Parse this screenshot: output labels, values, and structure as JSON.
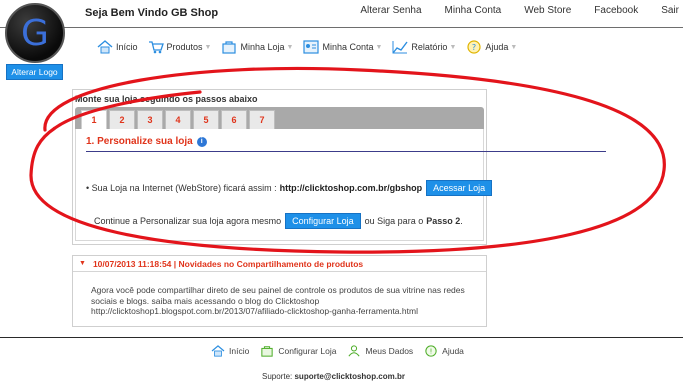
{
  "header": {
    "logo_letter": "G",
    "welcome": "Seja Bem Vindo GB Shop",
    "links": [
      "Alterar Senha",
      "Minha Conta",
      "Web Store",
      "Facebook",
      "Sair"
    ]
  },
  "menu": {
    "items": [
      {
        "label": "Início",
        "icon": "home-icon"
      },
      {
        "label": "Produtos",
        "icon": "cart-icon"
      },
      {
        "label": "Minha Loja",
        "icon": "bag-icon"
      },
      {
        "label": "Minha Conta",
        "icon": "account-icon"
      },
      {
        "label": "Relatório",
        "icon": "chart-icon"
      },
      {
        "label": "Ajuda",
        "icon": "help-icon"
      }
    ]
  },
  "sidebar": {
    "alter_logo": "Alterar Logo"
  },
  "wizard": {
    "title": "Monte sua loja seguindo os passos abaixo",
    "tabs": [
      "1",
      "2",
      "3",
      "4",
      "5",
      "6",
      "7"
    ],
    "step_title": "1. Personalize sua loja",
    "row1_text": "• Sua Loja na Internet (WebStore) ficará assim :",
    "row1_url": "http://clicktoshop.com.br/gbshop",
    "row1_button": "Acessar Loja",
    "row2_prefix": "Continue a Personalizar sua loja agora mesmo",
    "row2_button": "Configurar Loja",
    "row2_suffix": "ou Siga para o",
    "row2_step": "Passo 2",
    "row2_end": "."
  },
  "news": {
    "header": "10/07/2013 11:18:54 | Novidades no Compartilhamento de produtos",
    "body": "Agora você pode compartilhar direto de seu painel de controle os produtos de sua vitrine nas redes sociais e blogs. saiba mais acessando o blog do Clicktoshop http://clicktoshop1.blogspot.com.br/2013/07/afiliado-clicktoshop-ganha-ferramenta.html"
  },
  "footer": {
    "items": [
      {
        "label": "Início",
        "icon": "home-icon"
      },
      {
        "label": "Configurar Loja",
        "icon": "bag-icon"
      },
      {
        "label": "Meus Dados",
        "icon": "user-icon"
      },
      {
        "label": "Ajuda",
        "icon": "help-icon"
      }
    ],
    "support_label": "Suporte:",
    "support_email": "suporte@clicktoshop.com.br"
  },
  "colors": {
    "accent": "#1e90e8",
    "step_red": "#e0341b",
    "annotation": "#e3141b"
  }
}
